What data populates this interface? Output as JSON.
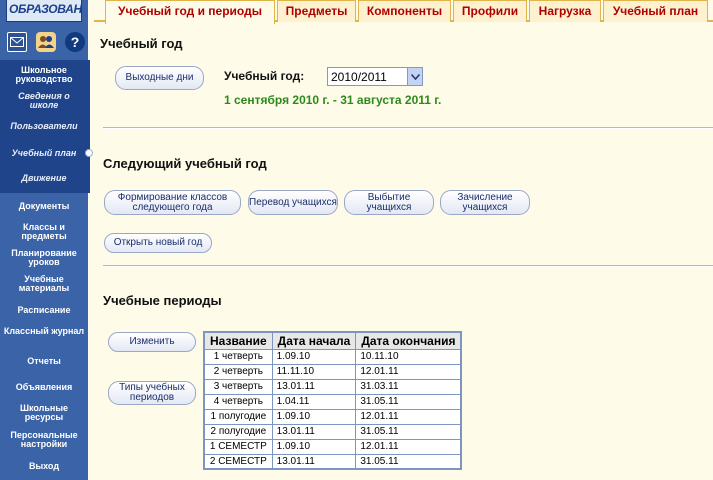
{
  "logo": {
    "text": "ОБРАЗОВАНИ"
  },
  "sidebar": {
    "icons": [
      "mail-icon",
      "users-icon",
      "help-icon"
    ],
    "group_items": [
      {
        "label": "Школьное руководство",
        "sub": false
      },
      {
        "label": "Сведения о школе",
        "sub": true
      },
      {
        "label": "Пользователи",
        "sub": true
      },
      {
        "label": "Учебный план",
        "sub": true
      },
      {
        "label": "Движение",
        "sub": true
      }
    ],
    "items": [
      {
        "label": "Документы"
      },
      {
        "label": "Классы и предметы"
      },
      {
        "label": "Планирование уроков"
      },
      {
        "label": "Учебные материалы"
      },
      {
        "label": "Расписание"
      },
      {
        "label": "Классный журнал"
      },
      {
        "label": "Отчеты"
      },
      {
        "label": "Объявления"
      },
      {
        "label": "Школьные ресурсы"
      },
      {
        "label": "Персональные настройки"
      },
      {
        "label": "Выход"
      }
    ]
  },
  "tabs": [
    {
      "label": "Учебный год и периоды",
      "active": true
    },
    {
      "label": "Предметы"
    },
    {
      "label": "Компоненты"
    },
    {
      "label": "Профили"
    },
    {
      "label": "Нагрузка"
    },
    {
      "label": "Учебный план"
    }
  ],
  "school_year": {
    "heading": "Учебный год",
    "holidays_button": "Выходные дни",
    "label": "Учебный год:",
    "selected": "2010/2011",
    "dates": "1 сентября 2010 г. - 31 августа 2011 г."
  },
  "next_year": {
    "heading": "Следующий учебный год",
    "buttons": {
      "form_classes": "Формирование классов следующего года",
      "transfer": "Перевод учащихся",
      "dropout": "Выбытие учащихся",
      "enroll": "Зачисление учащихся",
      "open_year": "Открыть новый год"
    }
  },
  "periods": {
    "heading": "Учебные периоды",
    "edit_button": "Изменить",
    "types_button": "Типы учебных периодов",
    "columns": [
      "Название",
      "Дата начала",
      "Дата окончания"
    ],
    "rows": [
      [
        "1 четверть",
        "1.09.10",
        "10.11.10"
      ],
      [
        "2 четверть",
        "11.11.10",
        "12.01.11"
      ],
      [
        "3 четверть",
        "13.01.11",
        "31.03.11"
      ],
      [
        "4 четверть",
        "1.04.11",
        "31.05.11"
      ],
      [
        "1 полугодие",
        "1.09.10",
        "12.01.11"
      ],
      [
        "2 полугодие",
        "13.01.11",
        "31.05.11"
      ],
      [
        "1 СЕМЕСТР",
        "1.09.10",
        "12.01.11"
      ],
      [
        "2 СЕМЕСТР",
        "13.01.11",
        "31.05.11"
      ]
    ]
  }
}
